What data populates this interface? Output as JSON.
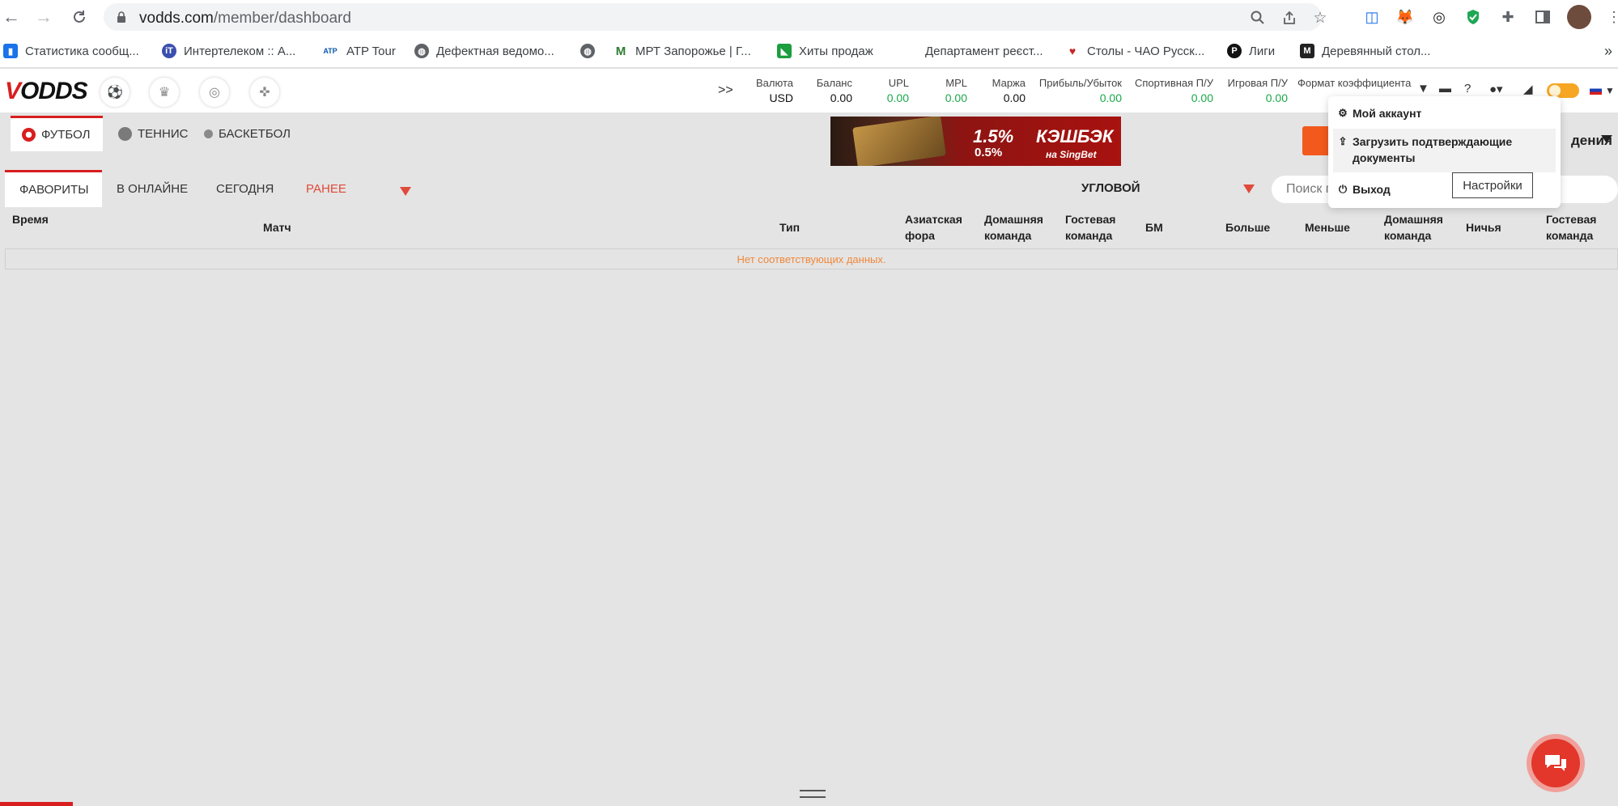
{
  "browser": {
    "url_host": "vodds.com",
    "url_path": "/member/dashboard",
    "bookmarks": [
      {
        "label": "Статистика сообщ...",
        "icon": "bar-chart-icon",
        "color": "#1a73e8"
      },
      {
        "label": "Интертелеком :: А...",
        "icon": "intertelecom-icon",
        "color": "#3b4fb0"
      },
      {
        "label": "ATP Tour",
        "icon": "atp-icon",
        "color": "#0a58a8"
      },
      {
        "label": "Дефектная ведомо...",
        "icon": "globe-icon",
        "color": "#5f6368"
      },
      {
        "label": "",
        "icon": "globe-icon",
        "color": "#5f6368"
      },
      {
        "label": "МРТ Запорожье | Г...",
        "icon": "mrt-icon",
        "color": "#2e7d32"
      },
      {
        "label": "Хиты продаж",
        "icon": "green-flag-icon",
        "color": "#1b9e3e"
      },
      {
        "label": "Департамент реєст...",
        "icon": "",
        "color": ""
      },
      {
        "label": "Столы - ЧАО Русск...",
        "icon": "heart-icon",
        "color": "#c62828"
      },
      {
        "label": "Лиги",
        "icon": "p-icon",
        "color": "#111111"
      },
      {
        "label": "Деревянный стол...",
        "icon": "m-icon",
        "color": "#222222"
      }
    ],
    "more": "»"
  },
  "header": {
    "logo_v": "V",
    "logo_rest": "ODDS",
    "chevron": ">>",
    "stats": [
      {
        "label": "Валюта",
        "value": "USD",
        "green": false
      },
      {
        "label": "Баланс",
        "value": "0.00",
        "green": false
      },
      {
        "label": "UPL",
        "value": "0.00",
        "green": true
      },
      {
        "label": "MPL",
        "value": "0.00",
        "green": true
      },
      {
        "label": "Маржа",
        "value": "0.00",
        "green": false
      },
      {
        "label": "Прибыль/Убыток",
        "value": "0.00",
        "green": true
      },
      {
        "label": "Спортивная П/У",
        "value": "0.00",
        "green": true
      },
      {
        "label": "Игровая П/У",
        "value": "0.00",
        "green": true
      }
    ],
    "odds_format_label": "Формат коэффициента"
  },
  "sport_tabs": [
    {
      "label": "ФУТБОЛ",
      "active": true
    },
    {
      "label": "ТЕННИС",
      "active": false
    },
    {
      "label": "БАСКЕТБОЛ",
      "active": false
    }
  ],
  "banner": {
    "pct_main": "1.5%",
    "pct_sub": "0.5%",
    "title": "КЭШБЭК",
    "sub": "на SingBet"
  },
  "right_label": "дения",
  "filter_tabs": [
    {
      "label": "ФАВОРИТЫ",
      "active": true,
      "red": false
    },
    {
      "label": "В ОНЛАЙНЕ",
      "active": false,
      "red": false
    },
    {
      "label": "СЕГОДНЯ",
      "active": false,
      "red": false
    },
    {
      "label": "РАНЕЕ",
      "active": false,
      "red": true
    }
  ],
  "market_select": "УГЛОВОЙ",
  "search": {
    "placeholder": "Поиск п"
  },
  "table": {
    "headers": [
      "Время",
      "Матч",
      "Тип",
      "Азиатская фора",
      "Домашняя команда",
      "Гостевая команда",
      "БМ",
      "Больше",
      "Меньше",
      "Домашняя команда",
      "Ничья",
      "Гостевая команда"
    ],
    "empty_text": "Нет соответствующих данных."
  },
  "account_menu": {
    "items": [
      "Мой аккаунт",
      "Загрузить подтверждающие документы",
      "Выход"
    ],
    "tooltip": "Настройки"
  },
  "colors": {
    "accent": "#d81e1e",
    "green": "#1aa84a",
    "orange": "#f25a1d"
  }
}
